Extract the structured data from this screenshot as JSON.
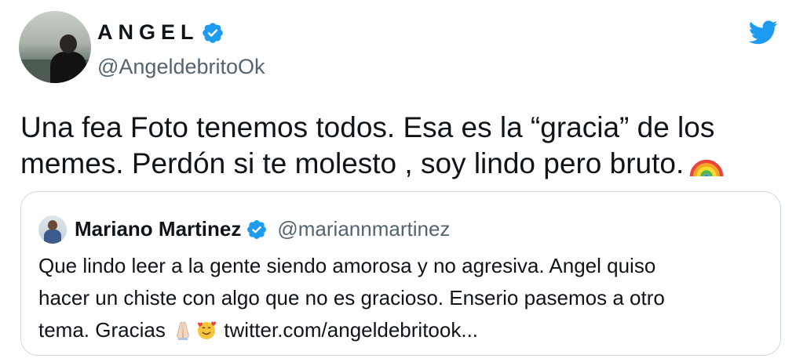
{
  "author": {
    "display_name": "ANGEL",
    "handle": "@AngeldebritoOk",
    "verified": true,
    "avatar": "person-photo-avatar"
  },
  "brand": {
    "icon": "twitter-bird-icon",
    "color": "#1d9bf0"
  },
  "tweet": {
    "text_lines": [
      "Una fea Foto tenemos todos. Esa es la “gracia” de los",
      "memes. Perdón si te molesto , soy lindo pero bruto."
    ],
    "emoji": "rainbow-emoji"
  },
  "quoted_tweet": {
    "display_name": "Mariano Martinez",
    "handle": "@mariannmartinez",
    "verified": true,
    "text_lines": [
      "Que lindo leer a la gente siendo amorosa y no agresiva. Angel quiso",
      "hacer un chiste con algo que no es gracioso. Enserio pasemos a otro",
      "tema. Gracias"
    ],
    "emojis": [
      "folded-hands-emoji",
      "smiling-face-with-hearts-emoji"
    ],
    "link": "twitter.com/angeldebritook..."
  },
  "colors": {
    "verified_badge": "#1d9bf0",
    "text_primary": "#0f1419",
    "text_secondary": "#536471",
    "border": "#cfd9de"
  }
}
